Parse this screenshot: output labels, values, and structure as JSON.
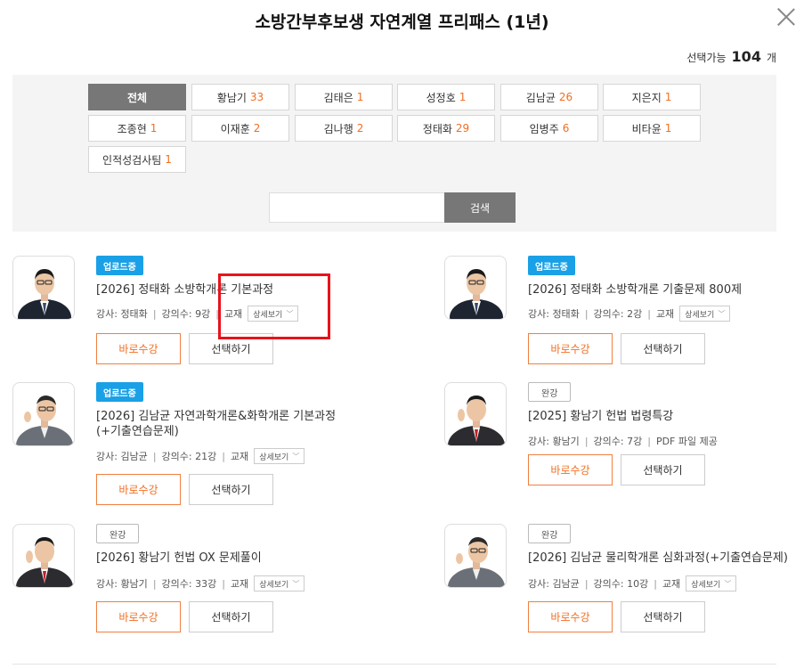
{
  "title": "소방간부후보생 자연계열 프리패스 (1년)",
  "count": {
    "label": "선택가능",
    "value": "104",
    "unit": "개"
  },
  "filters": [
    {
      "name": "전체",
      "count": "",
      "active": true
    },
    {
      "name": "황남기",
      "count": "33"
    },
    {
      "name": "김태은",
      "count": "1"
    },
    {
      "name": "성정호",
      "count": "1"
    },
    {
      "name": "김남균",
      "count": "26"
    },
    {
      "name": "지은지",
      "count": "1"
    },
    {
      "name": "조종현",
      "count": "1"
    },
    {
      "name": "이재훈",
      "count": "2"
    },
    {
      "name": "김나행",
      "count": "2"
    },
    {
      "name": "정태화",
      "count": "29"
    },
    {
      "name": "임병주",
      "count": "6"
    },
    {
      "name": "비타윤",
      "count": "1"
    },
    {
      "name": "인적성검사팀",
      "count": "1"
    }
  ],
  "search": {
    "placeholder": "",
    "button": "검색"
  },
  "courses": [
    {
      "badge": "업로드중",
      "badge_type": "upload",
      "title": "[2026] 정태화 소방학개론 기본과정",
      "teacher": "강사: 정태화",
      "lectures": "강의수: 9강",
      "material": "교재",
      "detail": "상세보기",
      "learn": "바로수강",
      "select": "선택하기"
    },
    {
      "badge": "업로드중",
      "badge_type": "upload",
      "title": "[2026] 정태화 소방학개론 기출문제 800제",
      "teacher": "강사: 정태화",
      "lectures": "강의수: 2강",
      "material": "교재",
      "detail": "상세보기",
      "learn": "바로수강",
      "select": "선택하기"
    },
    {
      "badge": "업로드중",
      "badge_type": "upload",
      "title": "[2026] 김남균 자연과학개론&화학개론 기본과정 (+기출연습문제)",
      "teacher": "강사: 김남균",
      "lectures": "강의수: 21강",
      "material": "교재",
      "detail": "상세보기",
      "learn": "바로수강",
      "select": "선택하기"
    },
    {
      "badge": "완강",
      "badge_type": "done",
      "title": "[2025] 황남기 헌법 법령특강",
      "teacher": "강사: 황남기",
      "lectures": "강의수: 7강",
      "material": "PDF 파일 제공",
      "detail": "",
      "learn": "바로수강",
      "select": "선택하기"
    },
    {
      "badge": "완강",
      "badge_type": "done",
      "title": "[2026] 황남기 헌법 OX 문제풀이",
      "teacher": "강사: 황남기",
      "lectures": "강의수: 33강",
      "material": "교재",
      "detail": "상세보기",
      "learn": "바로수강",
      "select": "선택하기"
    },
    {
      "badge": "완강",
      "badge_type": "done",
      "title": "[2026] 김남균 물리학개론 심화과정(+기출연습문제)",
      "teacher": "강사: 김남균",
      "lectures": "강의수: 10강",
      "material": "교재",
      "detail": "상세보기",
      "learn": "바로수강",
      "select": "선택하기"
    }
  ],
  "colors": {
    "accent": "#f26e22",
    "upload_badge": "#1aa0e6",
    "active_chip": "#777777",
    "highlight": "#e8131b"
  }
}
